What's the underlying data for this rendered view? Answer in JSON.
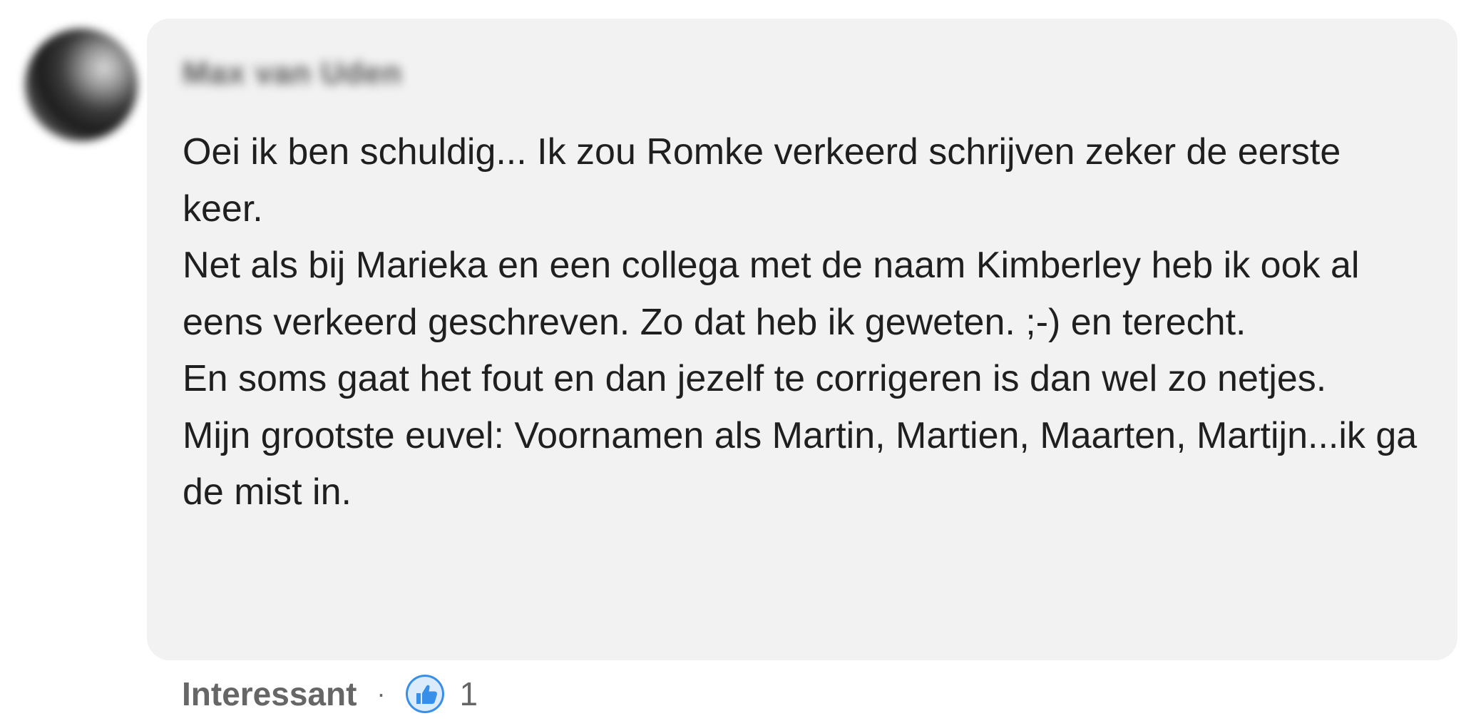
{
  "comment": {
    "author_name": "Max van Uden",
    "lines": [
      "Oei ik ben schuldig... Ik zou Romke verkeerd schrijven zeker de eerste keer.",
      "Net als bij Marieka en een collega met de naam Kimberley heb ik ook al eens verkeerd geschreven. Zo dat heb ik geweten. ;-) en terecht.",
      "En soms gaat het fout en dan jezelf te corrigeren is dan wel zo netjes.",
      "Mijn grootste euvel: Voornamen als Martin, Martien, Maarten, Martijn...ik ga de mist in."
    ]
  },
  "footer": {
    "reaction_label": "Interessant",
    "separator": "·",
    "reaction_icon": "thumbs-up-icon",
    "reaction_count": "1"
  },
  "colors": {
    "bubble_background": "#f2f2f2",
    "text": "#1f1f1f",
    "muted": "#666666",
    "like_blue": "#378fe9"
  }
}
